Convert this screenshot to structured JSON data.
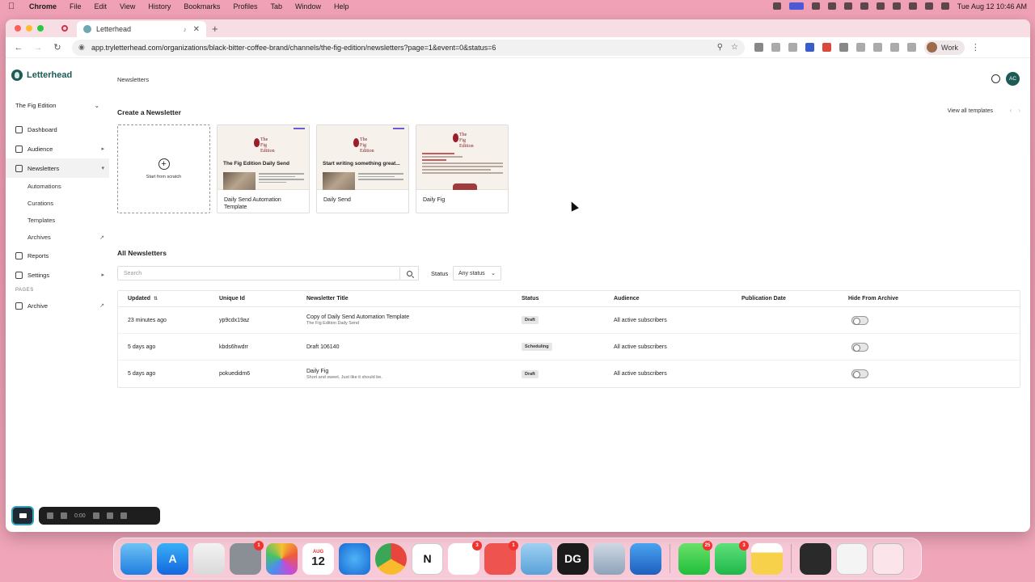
{
  "menubar": {
    "app": "Chrome",
    "items": [
      "File",
      "Edit",
      "View",
      "History",
      "Bookmarks",
      "Profiles",
      "Tab",
      "Window",
      "Help"
    ],
    "datetime": "Tue Aug 12  10:46 AM"
  },
  "browser": {
    "tab_title": "Letterhead",
    "url": "app.tryletterhead.com/organizations/black-bitter-coffee-brand/channels/the-fig-edition/newsletters?page=1&event=0&status=6",
    "profile_label": "Work"
  },
  "sidebar": {
    "logo": "Letterhead",
    "channel": "The Fig Edition",
    "items": {
      "dashboard": "Dashboard",
      "audience": "Audience",
      "newsletters": "Newsletters",
      "automations": "Automations",
      "curations": "Curations",
      "templates": "Templates",
      "archives": "Archives",
      "reports": "Reports",
      "settings": "Settings"
    },
    "pages_section": "PAGES",
    "archive_page": "Archive"
  },
  "header": {
    "breadcrumb": "Newsletters",
    "avatar_initials": "AC"
  },
  "create": {
    "title": "Create a Newsletter",
    "view_all": "View all templates",
    "scratch_label": "Start from scratch",
    "templates": [
      {
        "name": "Daily Send Automation Template",
        "headline": "The Fig Edition Daily Send"
      },
      {
        "name": "Daily Send",
        "headline": "Start writing something great..."
      },
      {
        "name": "Daily Fig",
        "headline": ""
      }
    ],
    "fig_logo_line1": "The",
    "fig_logo_line2": "Fig",
    "fig_logo_line3": "Edition"
  },
  "list": {
    "title": "All Newsletters",
    "search_placeholder": "Search",
    "status_label": "Status",
    "status_value": "Any status",
    "columns": [
      "Updated",
      "Unique Id",
      "Newsletter Title",
      "Status",
      "Audience",
      "Publication Date",
      "Hide From Archive"
    ],
    "rows": [
      {
        "updated": "23 minutes ago",
        "uid": "yp9cdx19az",
        "title": "Copy of Daily Send Automation Template",
        "subtitle": "The Fig Edition Daily Send",
        "status": "Draft",
        "audience": "All active subscribers",
        "pub": ""
      },
      {
        "updated": "5 days ago",
        "uid": "kbds6hwdrr",
        "title": "Draft 106140",
        "subtitle": "",
        "status": "Scheduling",
        "audience": "All active subscribers",
        "pub": ""
      },
      {
        "updated": "5 days ago",
        "uid": "pokuedidm6",
        "title": "Daily Fig",
        "subtitle": "Short and sweet. Just like it should be.",
        "status": "Draft",
        "audience": "All active subscribers",
        "pub": ""
      }
    ]
  },
  "recorder": {
    "time": "0:00"
  },
  "dock": {
    "calendar_month": "AUG",
    "calendar_day": "12",
    "badges": {
      "news": "1",
      "slack": "3",
      "misc": "1",
      "messages": "25",
      "facetime": "3"
    }
  }
}
